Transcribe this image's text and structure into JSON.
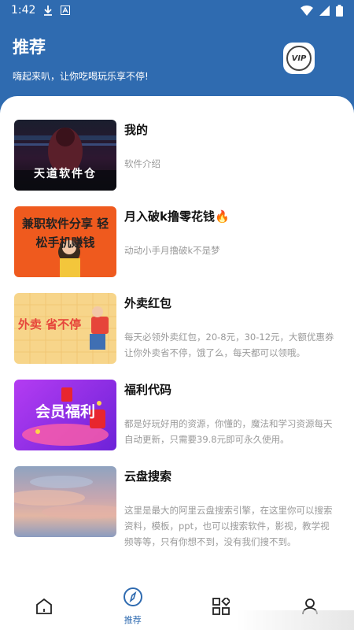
{
  "status_bar": {
    "time": "1:42",
    "icons": [
      "download-icon",
      "a-notification-icon",
      "wifi-icon",
      "signal-icon",
      "battery-icon"
    ]
  },
  "header": {
    "title": "推荐",
    "subtitle": "嗨起来叭，让你吃喝玩乐享不停!",
    "vip_label": "VIP"
  },
  "items": [
    {
      "title": "我的",
      "desc": "软件介绍",
      "thumb_caption": "天道软件仓"
    },
    {
      "title": "月入破k撸零花钱🔥",
      "desc": "动动小手月撸破k不是梦",
      "thumb_caption": "兼职软件分享 轻松手机赚钱"
    },
    {
      "title": "外卖红包",
      "desc": "每天必领外卖红包，20-8元，30-12元，大额优惠券让你外卖省不停，饿了么，每天都可以领哦。",
      "thumb_caption": "外卖 省不停"
    },
    {
      "title": "福利代码",
      "desc": "都是好玩好用的资源，你懂的，魔法和学习资源每天自动更新，只需要39.8元即可永久使用。",
      "thumb_caption": "会员福利"
    },
    {
      "title": "云盘搜索",
      "desc": "这里是最大的阿里云盘搜索引擎，在这里你可以搜索资料，模板，ppt，也可以搜索软件，影视，教学视频等等，只有你想不到，没有我们搜不到。",
      "thumb_caption": ""
    }
  ],
  "bottom_nav": {
    "active_label": "推荐",
    "items": [
      "home-icon",
      "compass-icon",
      "apps-grid-icon",
      "user-icon"
    ]
  },
  "colors": {
    "primary": "#2f6bb0",
    "background": "#ffffff",
    "muted_text": "#9a9a9a"
  }
}
